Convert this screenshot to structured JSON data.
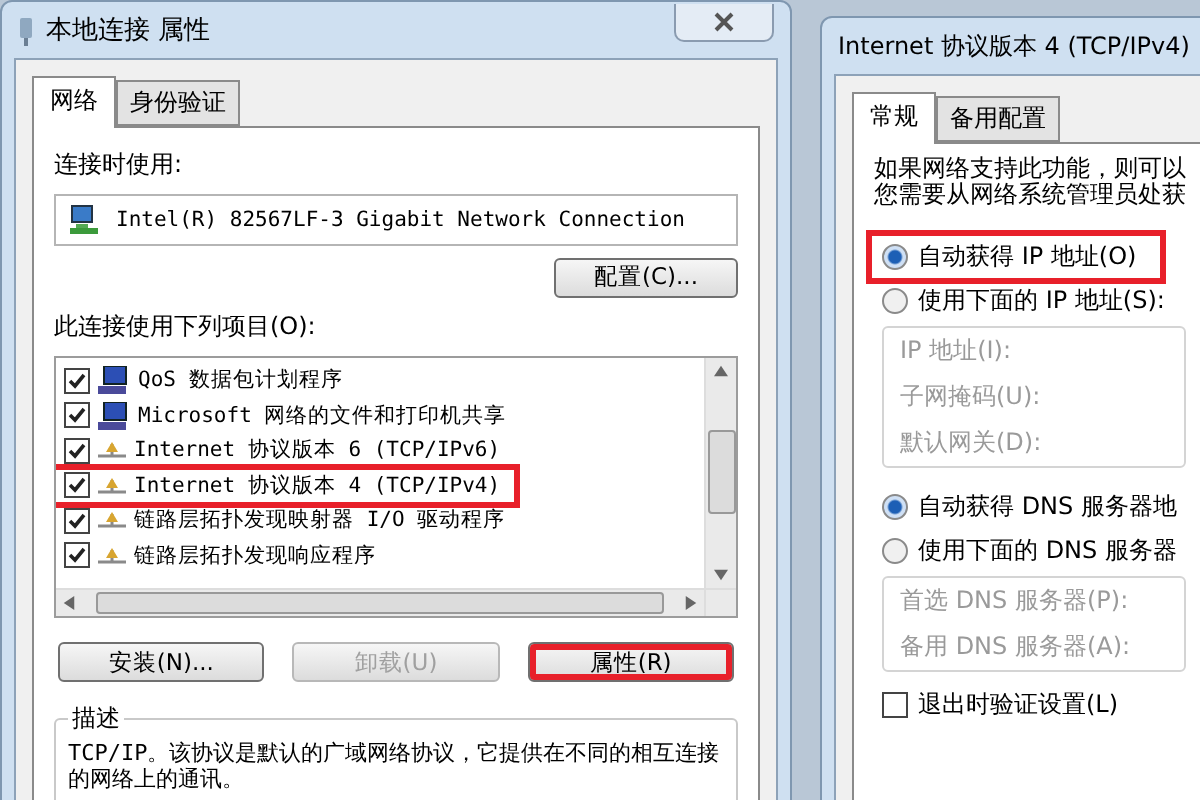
{
  "left_dialog": {
    "title": "本地连接 属性",
    "tabs": [
      {
        "label": "网络",
        "selected": true
      },
      {
        "label": "身份验证",
        "selected": false
      }
    ],
    "connect_using_label": "连接时使用:",
    "adapter": "Intel(R) 82567LF-3 Gigabit Network Connection",
    "configure_button": "配置(C)...",
    "items_label": "此连接使用下列项目(O):",
    "items": [
      {
        "kind": "service",
        "label": "QoS 数据包计划程序",
        "checked": true,
        "highlighted": false
      },
      {
        "kind": "service",
        "label": "Microsoft 网络的文件和打印机共享",
        "checked": true,
        "highlighted": false
      },
      {
        "kind": "protocol",
        "label": "Internet 协议版本 6 (TCP/IPv6)",
        "checked": true,
        "highlighted": false
      },
      {
        "kind": "protocol",
        "label": "Internet 协议版本 4 (TCP/IPv4)",
        "checked": true,
        "highlighted": true
      },
      {
        "kind": "protocol",
        "label": "链路层拓扑发现映射器 I/O 驱动程序",
        "checked": true,
        "highlighted": false
      },
      {
        "kind": "protocol",
        "label": "链路层拓扑发现响应程序",
        "checked": true,
        "highlighted": false
      }
    ],
    "buttons": [
      {
        "label": "安装(N)...",
        "disabled": false,
        "highlighted": false
      },
      {
        "label": "卸载(U)",
        "disabled": true,
        "highlighted": false
      },
      {
        "label": "属性(R)",
        "disabled": false,
        "highlighted": true
      }
    ],
    "description": {
      "title": "描述",
      "text": "TCP/IP。该协议是默认的广域网络协议，它提供在不同的相互连接的网络上的通讯。"
    }
  },
  "right_dialog": {
    "title": "Internet 协议版本 4 (TCP/IPv4)",
    "tabs": [
      {
        "label": "常规",
        "selected": true
      },
      {
        "label": "备用配置",
        "selected": false
      }
    ],
    "intro": [
      "如果网络支持此功能，则可以",
      "您需要从网络系统管理员处获"
    ],
    "ip_options": [
      {
        "label": "自动获得 IP 地址(O)",
        "selected": true,
        "highlighted": true
      },
      {
        "label": "使用下面的 IP 地址(S):",
        "selected": false,
        "highlighted": false
      }
    ],
    "ip_fields": {
      "disabled": true,
      "labels": [
        "IP 地址(I):",
        "子网掩码(U):",
        "默认网关(D):"
      ]
    },
    "dns_options": [
      {
        "label": "自动获得 DNS 服务器地",
        "selected": true,
        "highlighted": false
      },
      {
        "label": "使用下面的 DNS 服务器",
        "selected": false,
        "highlighted": false
      }
    ],
    "dns_fields": {
      "disabled": true,
      "labels": [
        "首选 DNS 服务器(P):",
        "备用 DNS 服务器(A):"
      ]
    },
    "validate": {
      "label": "退出时验证设置(L)",
      "checked": false
    }
  }
}
